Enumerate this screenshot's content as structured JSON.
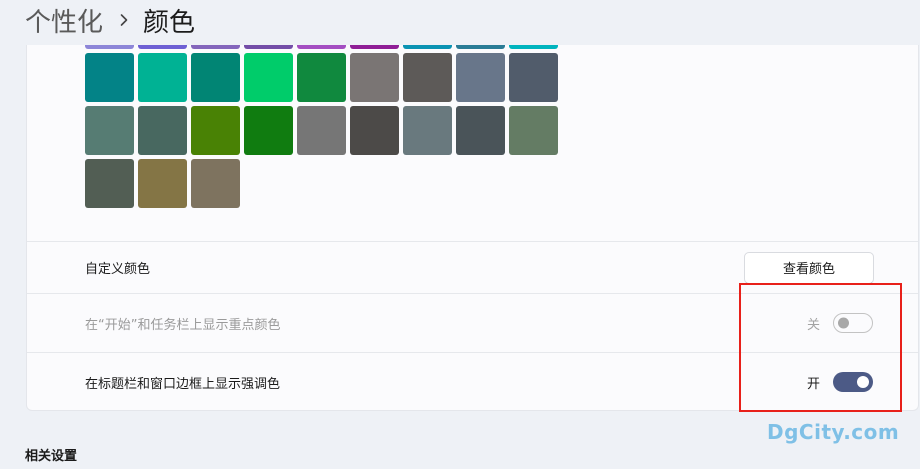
{
  "breadcrumb": {
    "parent": "个性化",
    "current": "颜色"
  },
  "swatches": {
    "rows": [
      [
        "#8d86d8",
        "#6e60d4",
        "#8466bc",
        "#744ea8",
        "#a44ec2",
        "#8f1e96",
        "#0a93b3",
        "#2a7c96",
        "#00b4be"
      ],
      [
        "#038387",
        "#00b294",
        "#018574",
        "#00cc6a",
        "#10893e",
        "#7a7574",
        "#5d5a58",
        "#68768a",
        "#515c6b"
      ],
      [
        "#567c73",
        "#486860",
        "#498205",
        "#107c10",
        "#767676",
        "#4c4a48",
        "#69797e",
        "#4a5459",
        "#647c64"
      ],
      [
        "#525e54",
        "#847545",
        "#7e735f"
      ]
    ]
  },
  "custom_color": {
    "label": "自定义颜色",
    "button": "查看颜色"
  },
  "start_taskbar_accent": {
    "label": "在“开始”和任务栏上显示重点颜色",
    "state_text": "关",
    "enabled": false
  },
  "titlebar_accent": {
    "label": "在标题栏和窗口边框上显示强调色",
    "state_text": "开",
    "enabled": true
  },
  "related_settings": {
    "title": "相关设置"
  },
  "watermark": "DgCity.com"
}
